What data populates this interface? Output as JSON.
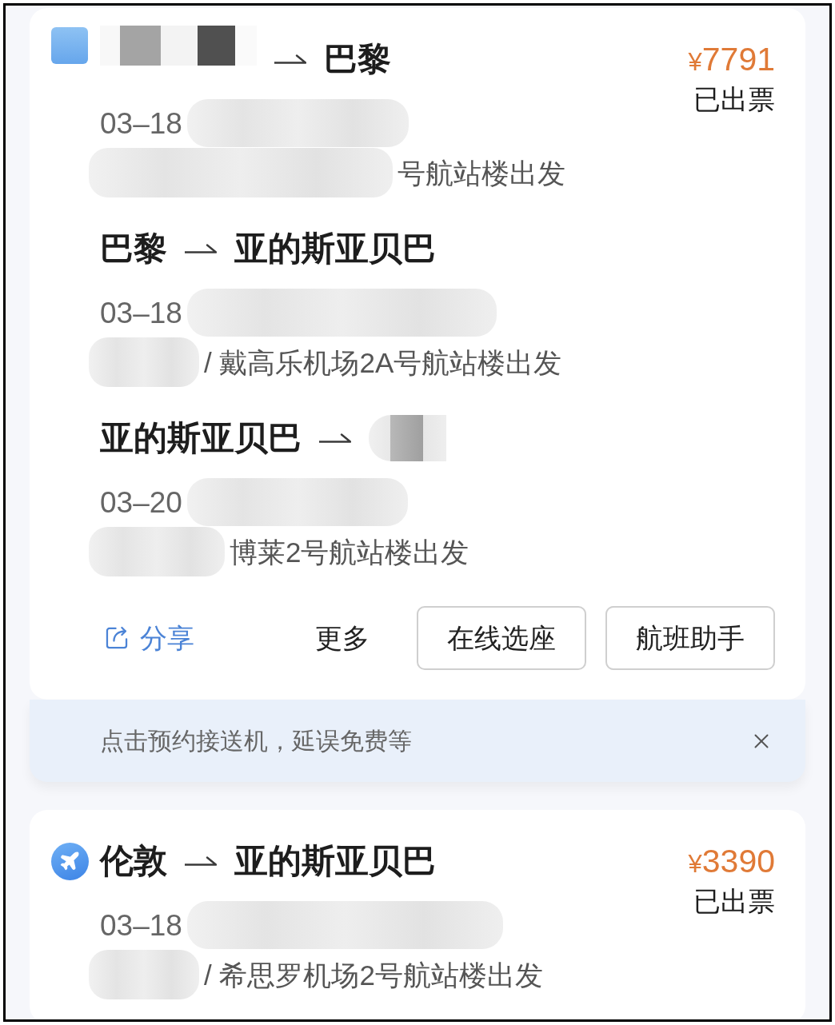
{
  "orders": [
    {
      "logo_hidden": true,
      "price": "¥7791",
      "status": "已出票",
      "legs": [
        {
          "to": "巴黎",
          "date": "03–18",
          "departure": "号航站楼出发"
        },
        {
          "from": "巴黎",
          "to": "亚的斯亚贝巴",
          "date": "03–18",
          "departure": "/ 戴高乐机场2A号航站楼出发"
        },
        {
          "from": "亚的斯亚贝巴",
          "date": "03–20",
          "departure": "博莱2号航站楼出发"
        }
      ],
      "actions": [
        {
          "kind": "share",
          "label": "分享"
        },
        {
          "kind": "more",
          "label": "更多"
        },
        {
          "kind": "button",
          "label": "在线选座"
        },
        {
          "kind": "button",
          "label": "航班助手"
        }
      ],
      "notice": {
        "text": "点击预约接送机，延误免费等"
      }
    },
    {
      "logo_hidden": false,
      "price": "¥3390",
      "status": "已出票",
      "legs": [
        {
          "from": "伦敦",
          "to": "亚的斯亚贝巴",
          "date": "03–18",
          "departure": "/ 希思罗机场2号航站楼出发"
        }
      ]
    }
  ]
}
